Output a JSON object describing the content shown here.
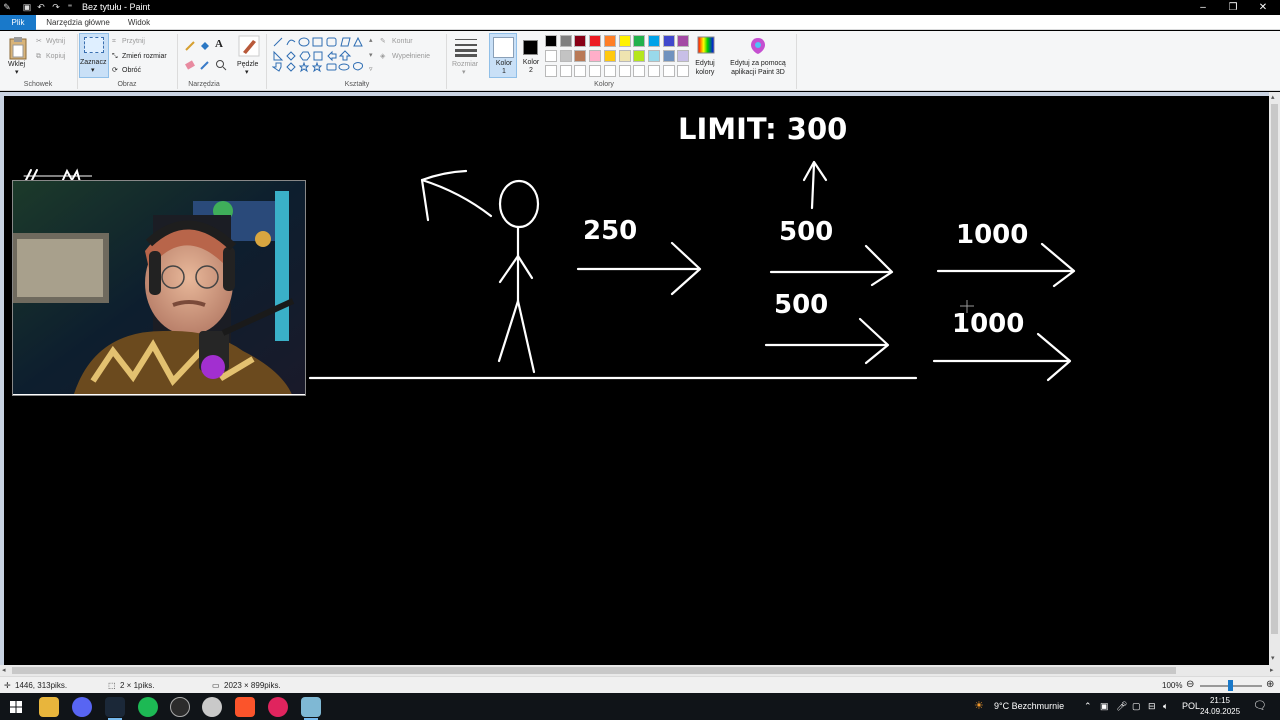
{
  "window": {
    "title": "Bez tytułu - Paint",
    "controls": [
      "–",
      "❐",
      "✕"
    ]
  },
  "tabs": [
    "Plik",
    "Narzędzia główne",
    "Widok"
  ],
  "ribbon": {
    "clipboard": {
      "paste": "Wklej",
      "cut": "Wytnij",
      "copy": "Kopiuj",
      "group": "Schowek"
    },
    "image": {
      "select": "Zaznacz",
      "crop": "Przytnij",
      "resize": "Zmień rozmiar",
      "rotate": "Obróć",
      "group": "Obraz"
    },
    "tools": {
      "group": "Narzędzia"
    },
    "brushes": {
      "label": "Pędzle"
    },
    "shapes": {
      "outline": "Kontur",
      "fill": "Wypełnienie",
      "group": "Kształty"
    },
    "size": {
      "label": "Rozmiar"
    },
    "colors": {
      "color1": "Kolor 1",
      "color2": "Kolor 2",
      "edit": "Edytuj kolory",
      "paint3d": "Edytuj za pomocą aplikacji Paint 3D",
      "group": "Kolory",
      "palette_row1": [
        "#000000",
        "#7f7f7f",
        "#880015",
        "#ed1c24",
        "#ff7f27",
        "#fff200",
        "#22b14c",
        "#00a2e8",
        "#3f48cc",
        "#a349a4"
      ],
      "palette_row2": [
        "#ffffff",
        "#c3c3c3",
        "#b97a57",
        "#ffaec9",
        "#ffc90e",
        "#efe4b0",
        "#b5e61d",
        "#99d9ea",
        "#7092be",
        "#c8bfe7"
      ]
    }
  },
  "canvas": {
    "labels": {
      "limit": "LIMIT: 300",
      "v250": "250",
      "v500_top": "500",
      "v500_bottom": "500",
      "v1000_top": "1000",
      "v1000_bottom": "1000"
    },
    "webcam_signature": "M"
  },
  "statusbar": {
    "cursor": "1446, 313piks.",
    "selection": "2 × 1piks.",
    "image_size": "2023 × 899piks.",
    "zoom": "100%"
  },
  "taskbar": {
    "weather": "9°C  Bezchmurnie",
    "lang": "POL",
    "time": "21:15",
    "date": "24.09.2025"
  }
}
